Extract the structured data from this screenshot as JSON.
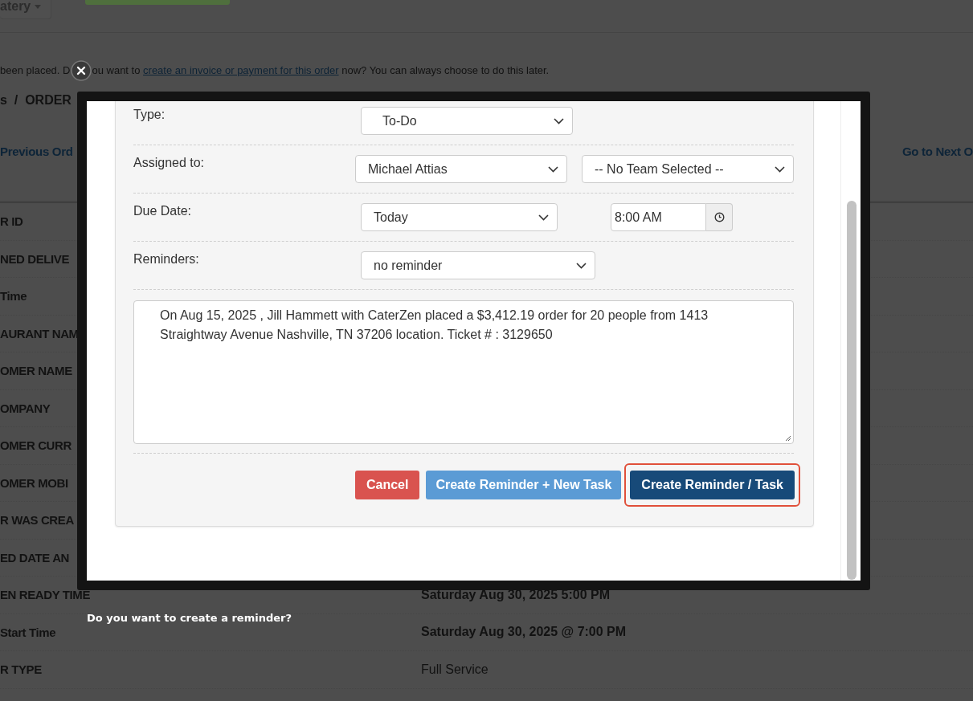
{
  "background_page": {
    "dropdown": "atery",
    "alert": {
      "before": "been placed. D",
      "after_gap": "ou want to ",
      "link": "create an invoice or payment for this order",
      "rest": " now? You can always choose to do this later."
    },
    "breadcrumb": "s  /  ORDER",
    "previous_link": "Previous Ord",
    "next_link": "Go to Next O",
    "rows": [
      {
        "label": "R ID"
      },
      {
        "label": "NED DELIVE"
      },
      {
        "label": "Time"
      },
      {
        "label": "AURANT NAM"
      },
      {
        "label": "OMER NAME"
      },
      {
        "label": "OMPANY"
      },
      {
        "label": "OMER CURR"
      },
      {
        "label": "OMER MOBI"
      },
      {
        "label": "R WAS CREA"
      },
      {
        "label": "ED DATE AN"
      },
      {
        "label": "EN READY TIME",
        "value": "Saturday Aug 30, 2025 5:00 PM",
        "bold": true
      },
      {
        "label": "Start Time",
        "value": "Saturday Aug 30, 2025 @ 7:00 PM",
        "bold": true
      },
      {
        "label": "R TYPE",
        "value": "Full Service",
        "bold": false
      }
    ]
  },
  "dialog": {
    "caption": "Do you want to create a reminder?",
    "fields": [
      {
        "label": "Type:",
        "controls": [
          {
            "kind": "select",
            "value": "To-Do"
          }
        ]
      },
      {
        "label": "Assigned to:",
        "controls": [
          {
            "kind": "select",
            "value": "Michael Attias"
          },
          {
            "kind": "select",
            "value": "-- No Team Selected --"
          }
        ]
      },
      {
        "label": "Due Date:",
        "controls": [
          {
            "kind": "select",
            "value": "Today"
          },
          {
            "kind": "time",
            "value": "8:00 AM"
          }
        ]
      },
      {
        "label": "Reminders:",
        "controls": [
          {
            "kind": "select",
            "value": "no reminder"
          }
        ]
      }
    ],
    "description": "On Aug 15, 2025 , Jill Hammett with CaterZen placed a $3,412.19 order for 20 people from 1413 Straightway Avenue Nashville, TN 37206 location. Ticket # : 3129650",
    "buttons": [
      {
        "label": "Cancel",
        "kind": "danger",
        "highlighted": false
      },
      {
        "label": "Create Reminder + New Task",
        "kind": "info",
        "highlighted": false
      },
      {
        "label": "Create Reminder / Task",
        "kind": "primary",
        "highlighted": true
      }
    ]
  }
}
